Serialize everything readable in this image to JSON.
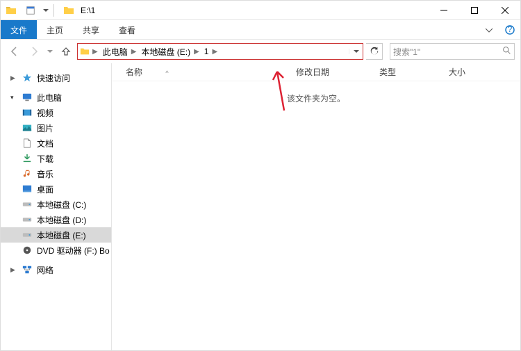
{
  "window": {
    "title": "E:\\1",
    "minimize": "−",
    "maximize": "□",
    "close": "×"
  },
  "ribbon": {
    "file": "文件",
    "home": "主页",
    "share": "共享",
    "view": "查看"
  },
  "breadcrumbs": {
    "pc": "此电脑",
    "drive": "本地磁盘 (E:)",
    "folder": "1"
  },
  "search": {
    "placeholder": "搜索\"1\""
  },
  "sidebar": {
    "quick": "快速访问",
    "thispc": "此电脑",
    "videos": "视频",
    "pictures": "图片",
    "documents": "文档",
    "downloads": "下载",
    "music": "音乐",
    "desktop": "桌面",
    "driveC": "本地磁盘 (C:)",
    "driveD": "本地磁盘 (D:)",
    "driveE": "本地磁盘 (E:)",
    "dvd": "DVD 驱动器 (F:) Bo",
    "network": "网络"
  },
  "columns": {
    "name": "名称",
    "date": "修改日期",
    "type": "类型",
    "size": "大小"
  },
  "empty_msg": "该文件夹为空。"
}
